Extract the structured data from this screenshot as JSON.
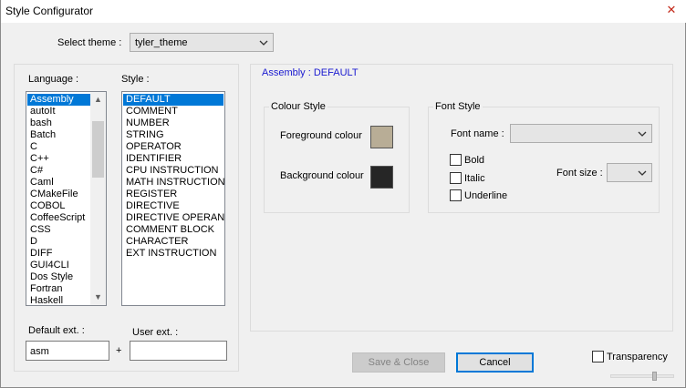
{
  "window": {
    "title": "Style Configurator",
    "close_glyph": "✕"
  },
  "theme": {
    "label": "Select theme :",
    "value": "tyler_theme"
  },
  "language": {
    "label": "Language :",
    "items": [
      "Assembly",
      "autoIt",
      "bash",
      "Batch",
      "C",
      "C++",
      "C#",
      "Caml",
      "CMakeFile",
      "COBOL",
      "CoffeeScript",
      "CSS",
      "D",
      "DIFF",
      "GUI4CLI",
      "Dos Style",
      "Fortran",
      "Haskell"
    ],
    "selected_index": 0
  },
  "style": {
    "label": "Style :",
    "items": [
      "DEFAULT",
      "COMMENT",
      "NUMBER",
      "STRING",
      "OPERATOR",
      "IDENTIFIER",
      "CPU INSTRUCTION",
      "MATH INSTRUCTION",
      "REGISTER",
      "DIRECTIVE",
      "DIRECTIVE OPERAND",
      "COMMENT BLOCK",
      "CHARACTER",
      "EXT INSTRUCTION"
    ],
    "selected_index": 0
  },
  "ext": {
    "default_label": "Default ext. :",
    "default_value": "asm",
    "plus": "+",
    "user_label": "User ext. :",
    "user_value": ""
  },
  "detail_title": "Assembly : DEFAULT",
  "colour_style": {
    "title": "Colour Style",
    "fg_label": "Foreground colour",
    "bg_label": "Background colour",
    "fg_color": "#b8ad96",
    "bg_color": "#262626"
  },
  "font_style": {
    "title": "Font Style",
    "name_label": "Font name :",
    "name_value": "",
    "bold_label": "Bold",
    "italic_label": "Italic",
    "underline_label": "Underline",
    "size_label": "Font size :",
    "size_value": ""
  },
  "buttons": {
    "save_close": "Save & Close",
    "cancel": "Cancel"
  },
  "transparency": {
    "label": "Transparency",
    "checked": false
  },
  "colors": {
    "accent": "#0078d7",
    "link_title": "#1a1ad0"
  }
}
